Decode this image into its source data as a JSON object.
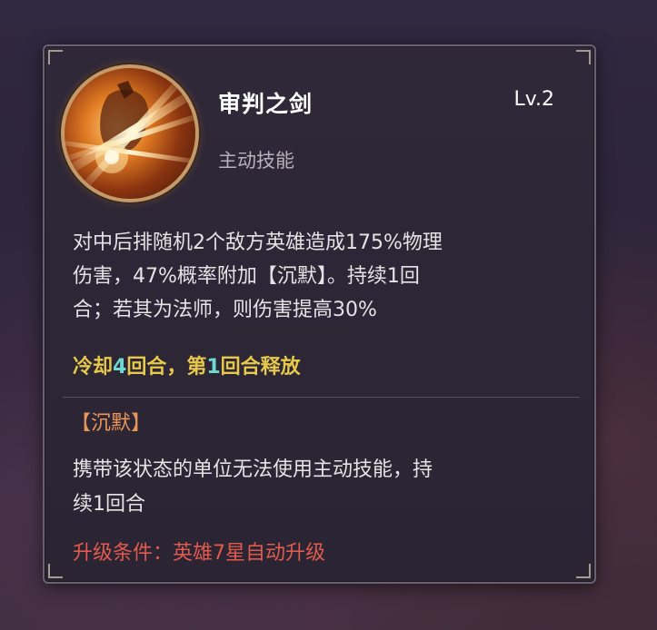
{
  "skill": {
    "name": "审判之剑",
    "level": "Lv.2",
    "type": "主动技能",
    "icon": "sword-slash-icon",
    "description_lines": [
      "对中后排随机2个敌方英雄造成175%物理",
      "伤害，47%概率附加【沉默】。持续1回",
      "合；若其为法师，则伤害提高30%"
    ],
    "cooldown": {
      "prefix": "冷却",
      "cooldown_turns": "4",
      "mid": "回合，第",
      "release_turn": "1",
      "suffix": "回合释放"
    }
  },
  "status_effect": {
    "title": "【沉默】",
    "description_lines": [
      "携带该状态的单位无法使用主动技能，持",
      "续1回合"
    ]
  },
  "upgrade_condition": "升级条件：英雄7星自动升级",
  "colors": {
    "highlight_yellow": "#e6c84a",
    "highlight_cyan": "#6fd8d0",
    "status_orange": "#e8955a",
    "upgrade_red": "#e05a4e"
  }
}
